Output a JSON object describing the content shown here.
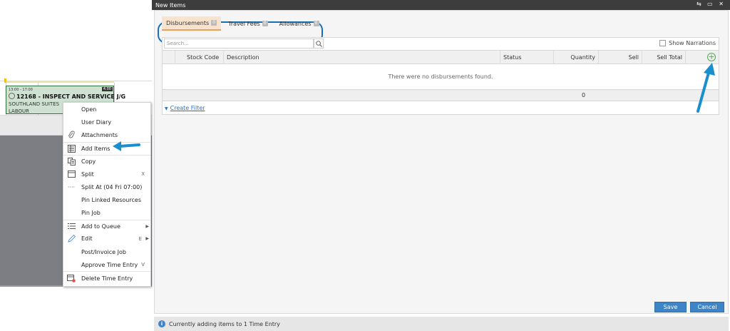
{
  "dialog": {
    "title": "New Items",
    "window_controls": "⇆ ▭ ✕"
  },
  "tabs": [
    {
      "label": "Disbursements",
      "count": "0",
      "active": true
    },
    {
      "label": "Travel Fees",
      "count": "0",
      "active": false
    },
    {
      "label": "Allowances",
      "count": "0",
      "active": false
    }
  ],
  "grid": {
    "search_placeholder": "Search...",
    "show_narrations_label": "Show Narrations",
    "columns": [
      "",
      "Stock Code",
      "Description",
      "Status",
      "Quantity",
      "Sell",
      "Sell Total"
    ],
    "empty_message": "There were no disbursements found.",
    "total_quantity": "0",
    "create_filter_label": "Create Filter"
  },
  "buttons": {
    "save": "Save",
    "cancel": "Cancel"
  },
  "status_bar": {
    "message": "Currently adding items to 1 Time Entry"
  },
  "job_card": {
    "time": "13:00 - 17:00",
    "hours": "4.00",
    "title": "12168 - INSPECT AND SERVICE J/G",
    "line1": "SOUTHLAND SUITES",
    "line2": "LABOUR"
  },
  "context_menu": {
    "items": [
      {
        "label": "Open",
        "icon": "",
        "shortcut": ""
      },
      {
        "label": "User Diary",
        "icon": "",
        "shortcut": ""
      },
      {
        "label": "Attachments",
        "icon": "paperclip-icon",
        "shortcut": ""
      },
      {
        "label": "Add Items",
        "icon": "list-icon",
        "shortcut": ""
      },
      {
        "label": "Copy",
        "icon": "copy-icon",
        "shortcut": ""
      },
      {
        "label": "Split",
        "icon": "split-icon",
        "shortcut": "X"
      },
      {
        "label": "Split At (04 Fri 07:00)",
        "icon": "dots-icon",
        "shortcut": ""
      },
      {
        "label": "Pin Linked Resources",
        "icon": "",
        "shortcut": ""
      },
      {
        "label": "Pin Job",
        "icon": "",
        "shortcut": ""
      },
      {
        "label": "Add to Queue",
        "icon": "queue-icon",
        "shortcut": ""
      },
      {
        "label": "Edit",
        "icon": "pencil-icon",
        "shortcut": "E"
      },
      {
        "label": "Post/Invoice Job",
        "icon": "",
        "shortcut": ""
      },
      {
        "label": "Approve Time Entry",
        "icon": "",
        "shortcut": "V"
      },
      {
        "label": "Delete Time Entry",
        "icon": "delete-entry-icon",
        "shortcut": ""
      }
    ]
  },
  "colors": {
    "accent_blue": "#3d85c6",
    "annotation_blue": "#1a8fd0",
    "active_tab_bg": "#f9e3cc",
    "title_bar": "#3d3d3d",
    "add_green": "#4cae4c"
  }
}
